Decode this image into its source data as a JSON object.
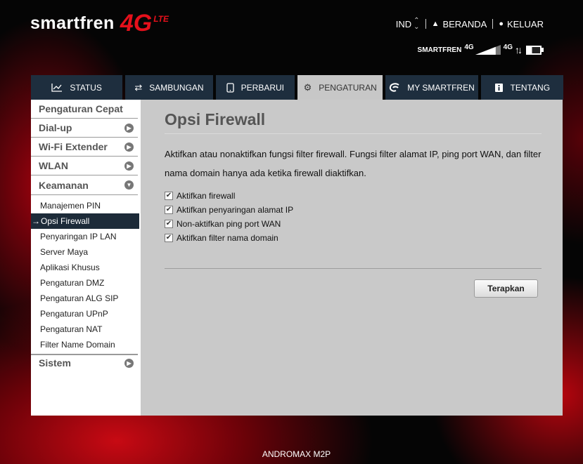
{
  "brand": {
    "name": "smartfren",
    "badge": "4G",
    "badge_sub": "LTE"
  },
  "header": {
    "lang": "IND",
    "home_label": "BERANDA",
    "logout_label": "KELUAR"
  },
  "status": {
    "carrier": "SMARTFREN",
    "network_type": "4G",
    "network_type_2": "4G",
    "signal_level": 0.8,
    "battery_level": 0.35
  },
  "nav": {
    "tabs": [
      {
        "label": "STATUS",
        "icon": "chart-icon"
      },
      {
        "label": "SAMBUNGAN",
        "icon": "transfer-icon"
      },
      {
        "label": "PERBARUI",
        "icon": "update-icon"
      },
      {
        "label": "PENGATURAN",
        "icon": "gear-icon"
      },
      {
        "label": "MY SMARTFREN",
        "icon": "smartfren-icon"
      },
      {
        "label": "TENTANG",
        "icon": "info-icon"
      }
    ]
  },
  "sidebar": {
    "quick": "Pengaturan Cepat",
    "dialup": "Dial-up",
    "wifi_extender": "Wi-Fi Extender",
    "wlan": "WLAN",
    "security": "Keamanan",
    "security_items": [
      "Manajemen PIN",
      "Opsi Firewall",
      "Penyaringan IP LAN",
      "Server Maya",
      "Aplikasi Khusus",
      "Pengaturan DMZ",
      "Pengaturan ALG SIP",
      "Pengaturan UPnP",
      "Pengaturan NAT",
      "Filter Name Domain"
    ],
    "active_marker": "→",
    "system": "Sistem"
  },
  "main": {
    "title": "Opsi Firewall",
    "description": "Aktifkan atau nonaktifkan fungsi filter firewall. Fungsi filter alamat IP, ping port WAN, dan filter nama domain hanya ada ketika firewall diaktifkan.",
    "options": [
      {
        "label": "Aktifkan firewall",
        "checked": true
      },
      {
        "label": "Aktifkan penyaringan alamat IP",
        "checked": true
      },
      {
        "label": "Non-aktifkan ping port WAN",
        "checked": true
      },
      {
        "label": "Aktifkan filter nama domain",
        "checked": true
      }
    ],
    "apply_label": "Terapkan"
  },
  "footer": {
    "model": "ANDROMAX M2P"
  }
}
